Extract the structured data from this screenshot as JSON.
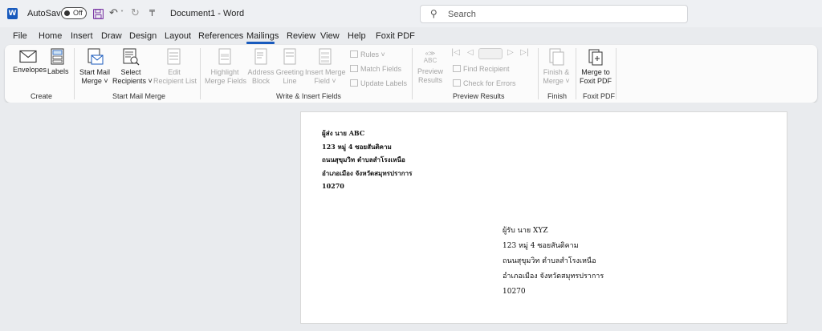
{
  "titlebar": {
    "app_icon": "word-icon",
    "autosave_label": "AutoSave",
    "autosave_state": "Off",
    "doc_title": "Document1 - Word",
    "search_placeholder": "Search"
  },
  "menu": {
    "tabs": [
      "File",
      "Home",
      "Insert",
      "Draw",
      "Design",
      "Layout",
      "References",
      "Mailings",
      "Review",
      "View",
      "Help",
      "Foxit PDF"
    ],
    "active": "Mailings"
  },
  "ribbon": {
    "groups": {
      "create": "Create",
      "start_mail_merge": "Start Mail Merge",
      "write_insert": "Write & Insert Fields",
      "preview": "Preview Results",
      "finish": "Finish",
      "foxit": "Foxit PDF"
    },
    "buttons": {
      "envelopes": "Envelopes",
      "labels": "Labels",
      "start_mail_merge_1": "Start Mail",
      "start_mail_merge_2": "Merge ˅",
      "select_recipients_1": "Select",
      "select_recipients_2": "Recipients ˅",
      "edit_recipient_1": "Edit",
      "edit_recipient_2": "Recipient List",
      "highlight_1": "Highlight",
      "highlight_2": "Merge Fields",
      "address_1": "Address",
      "address_2": "Block",
      "greeting_1": "Greeting",
      "greeting_2": "Line",
      "insert_merge_1": "Insert Merge",
      "insert_merge_2": "Field ˅",
      "rules": "Rules ˅",
      "match_fields": "Match Fields",
      "update_labels": "Update Labels",
      "preview_1": "Preview",
      "preview_2": "Results",
      "preview_icon_text": "ABC",
      "find_recipient": "Find Recipient",
      "check_errors": "Check for Errors",
      "finish_1": "Finish &",
      "finish_2": "Merge ˅",
      "merge_pdf_1": "Merge to",
      "merge_pdf_2": "Foxit PDF"
    }
  },
  "document": {
    "sender": [
      "ผู้ส่ง นาย ABC",
      "123 หมู่ 4 ซอยสันติคาม",
      "ถนนสุขุมวิท ตำบลสำโรงเหนือ",
      "อำเภอเมือง จังหวัดสมุทรปราการ",
      "10270"
    ],
    "recipient": [
      "ผู้รับ นาย XYZ",
      "123 หมู่ 4 ซอยสันติคาม",
      "ถนนสุขุมวิท ตำบลสำโรงเหนือ",
      "อำเภอเมือง จังหวัดสมุทรปราการ",
      "10270"
    ]
  },
  "colors": {
    "accent": "#185abd",
    "ribbon_bg": "#fbfbfb",
    "canvas_bg": "#e9ebee",
    "disabled_text": "#a5a5a5"
  }
}
